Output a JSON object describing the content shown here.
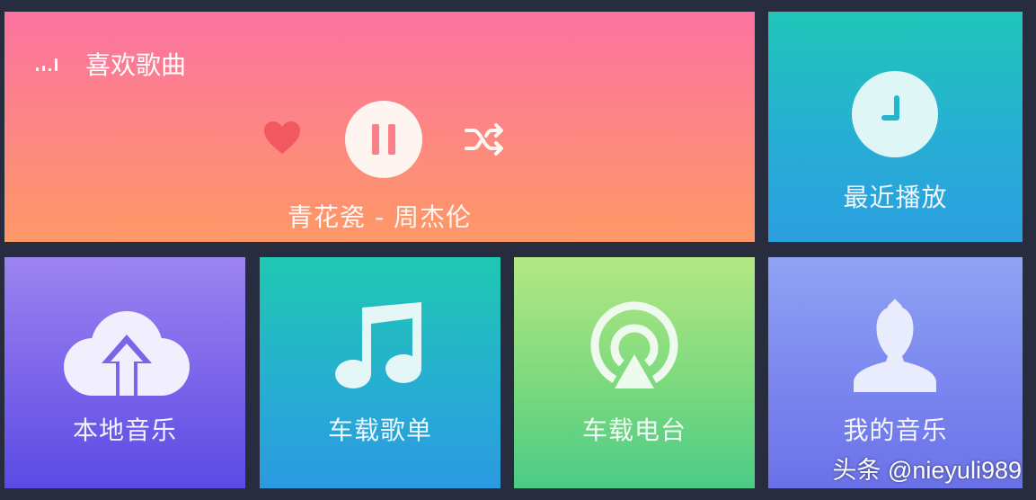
{
  "favorites": {
    "title": "喜欢歌曲",
    "now_playing": "青花瓷 - 周杰伦",
    "icons": [
      "signal-bars-icon",
      "heart-icon",
      "pause-icon",
      "shuffle-icon"
    ],
    "colors": {
      "top": "#fc72a0",
      "bottom": "#fe9866"
    }
  },
  "tiles": {
    "recent": {
      "label": "最近播放",
      "icon": "clock-icon"
    },
    "local": {
      "label": "本地音乐",
      "icon": "cloud-upload-icon"
    },
    "playlist": {
      "label": "车载歌单",
      "icon": "music-note-icon"
    },
    "radio": {
      "label": "车载电台",
      "icon": "radio-broadcast-icon"
    },
    "mine": {
      "label": "我的音乐",
      "icon": "user-icon"
    }
  },
  "watermark": "头条 @nieyuli989"
}
